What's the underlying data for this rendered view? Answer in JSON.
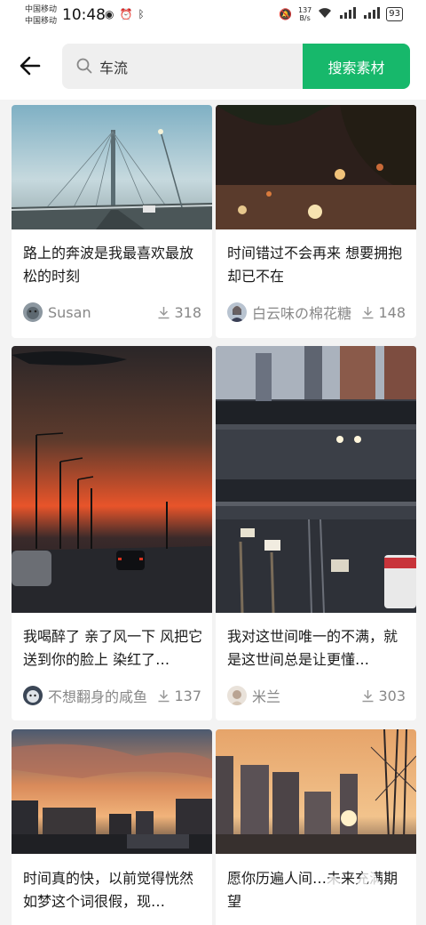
{
  "status_bar": {
    "carrier1": "中国移动",
    "carrier2": "中国移动",
    "time": "10:48",
    "net_speed_value": "137",
    "net_speed_unit": "B/s",
    "battery": "93"
  },
  "header": {
    "search_value": "车流",
    "search_button_label": "搜索素材"
  },
  "cards": [
    {
      "caption": "路上的奔波是我最喜欢最放松的时刻",
      "author": "Susan",
      "downloads": "318"
    },
    {
      "caption": "时间错过不会再来 想要拥抱却已不在",
      "author": "白云味の棉花糖",
      "downloads": "148"
    },
    {
      "caption": "我喝醉了 亲了风一下 风把它送到你的脸上 染红了…",
      "author": "不想翻身的咸鱼",
      "downloads": "137"
    },
    {
      "caption": "我对这世间唯一的不满，就是这世间总是让更懂…",
      "author": "米兰",
      "downloads": "303"
    },
    {
      "caption": "时间真的快，以前觉得恍然如梦这个词很假，现…",
      "author": "",
      "downloads": ""
    },
    {
      "caption": "愿你历遍人间…未来充满期望",
      "author": "",
      "downloads": ""
    }
  ]
}
